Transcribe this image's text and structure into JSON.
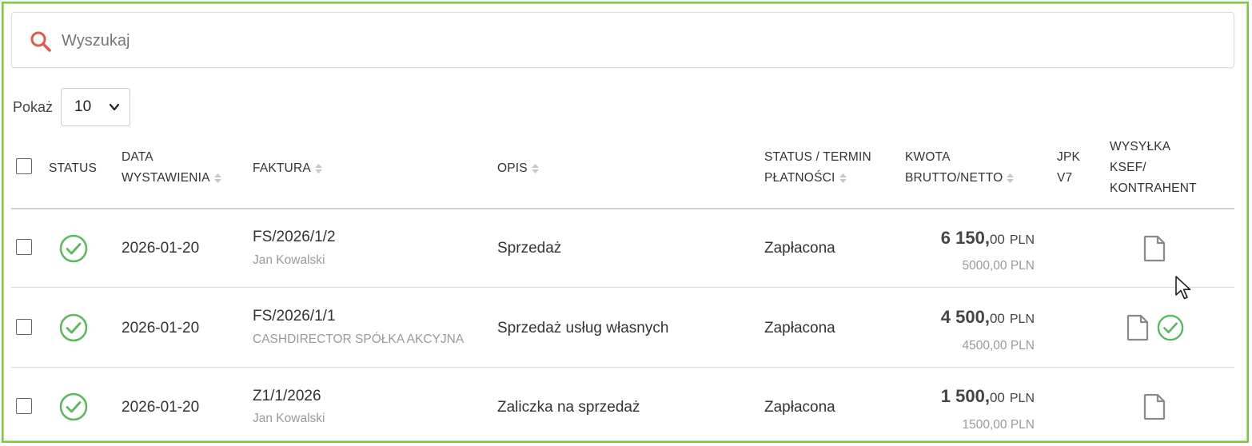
{
  "search": {
    "placeholder": "Wyszukaj"
  },
  "page_size": {
    "label": "Pokaż",
    "value": "10"
  },
  "columns": {
    "status": "STATUS",
    "date_l1": "DATA",
    "date_l2": "WYSTAWIENIA",
    "invoice": "FAKTURA",
    "desc": "OPIS",
    "payment_l1": "STATUS / TERMIN",
    "payment_l2": "PŁATNOŚCI",
    "amount_l1": "KWOTA",
    "amount_l2": "BRUTTO/NETTO",
    "jpk_l1": "JPK",
    "jpk_l2": "V7",
    "ksef_l1": "WYSYŁKA",
    "ksef_l2": "KSEF/",
    "ksef_l3": "KONTRAHENT"
  },
  "rows": [
    {
      "date": "2026-01-20",
      "invoice": "FS/2026/1/2",
      "client": "Jan Kowalski",
      "desc": "Sprzedaż",
      "payment": "Zapłacona",
      "gross_main": "6 150,",
      "gross_cents": "00",
      "currency": "PLN",
      "net": "5000,00 PLN",
      "ksef_sent": false
    },
    {
      "date": "2026-01-20",
      "invoice": "FS/2026/1/1",
      "client": "CASHDIRECTOR SPÓŁKA AKCYJNA",
      "desc": "Sprzedaż usług własnych",
      "payment": "Zapłacona",
      "gross_main": "4 500,",
      "gross_cents": "00",
      "currency": "PLN",
      "net": "4500,00 PLN",
      "ksef_sent": true
    },
    {
      "date": "2026-01-20",
      "invoice": "Z1/1/2026",
      "client": "Jan Kowalski",
      "desc": "Zaliczka na sprzedaż",
      "payment": "Zapłacona",
      "gross_main": "1 500,",
      "gross_cents": "00",
      "currency": "PLN",
      "net": "1500,00 PLN",
      "ksef_sent": false
    }
  ],
  "colors": {
    "frame": "#7ac943",
    "status_ok": "#5cb85c",
    "search_icon": "#e05a47",
    "doc_icon": "#8a8a8a"
  }
}
